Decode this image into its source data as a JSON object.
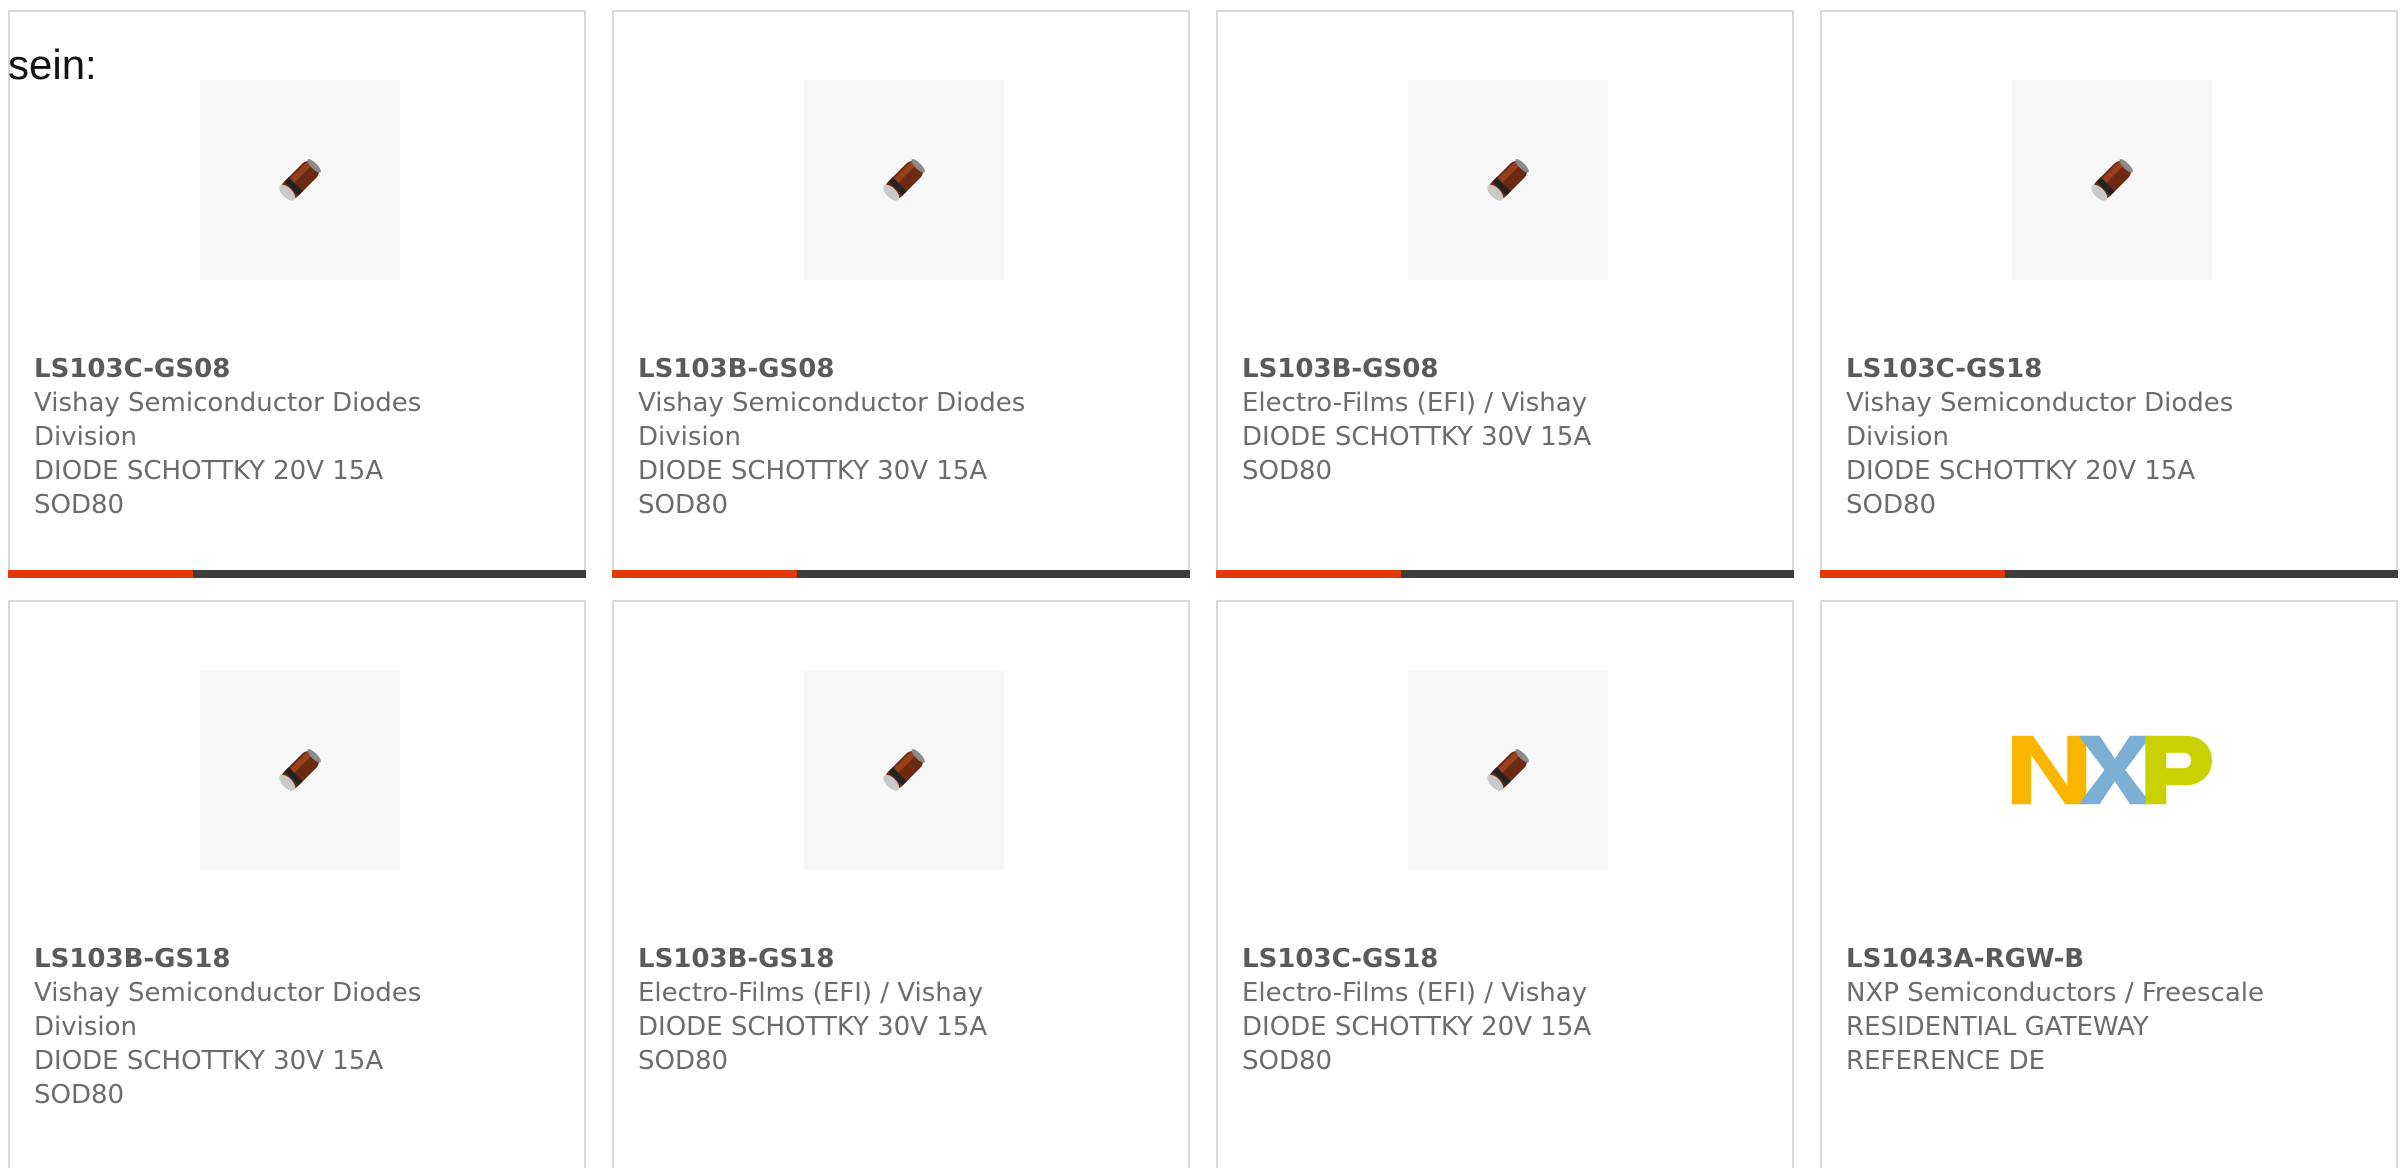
{
  "heading": "sein:",
  "colors": {
    "accent": "#e2380b",
    "bar_track": "#3d3d3d",
    "card_border": "#d8d8d8",
    "text": "#6c6c6c"
  },
  "cards": [
    {
      "part_number": "LS103C-GS08",
      "manufacturer_line1": "Vishay Semiconductor Diodes",
      "manufacturer_line2": "Division",
      "description_line1": "DIODE SCHOTTKY 20V 15A",
      "description_line2": "SOD80",
      "image_icon": "diode-image",
      "progress": 0.32
    },
    {
      "part_number": "LS103B-GS08",
      "manufacturer_line1": "Vishay Semiconductor Diodes",
      "manufacturer_line2": "Division",
      "description_line1": "DIODE SCHOTTKY 30V 15A",
      "description_line2": "SOD80",
      "image_icon": "diode-image",
      "progress": 0.32
    },
    {
      "part_number": "LS103B-GS08",
      "manufacturer_line1": "Electro-Films (EFI) / Vishay",
      "manufacturer_line2": "",
      "description_line1": "DIODE SCHOTTKY 30V 15A",
      "description_line2": "SOD80",
      "image_icon": "diode-image",
      "progress": 0.32
    },
    {
      "part_number": "LS103C-GS18",
      "manufacturer_line1": "Vishay Semiconductor Diodes",
      "manufacturer_line2": "Division",
      "description_line1": "DIODE SCHOTTKY 20V 15A",
      "description_line2": "SOD80",
      "image_icon": "diode-image",
      "progress": 0.32
    },
    {
      "part_number": "LS103B-GS18",
      "manufacturer_line1": "Vishay Semiconductor Diodes",
      "manufacturer_line2": "Division",
      "description_line1": "DIODE SCHOTTKY 30V 15A",
      "description_line2": "SOD80",
      "image_icon": "diode-image",
      "progress": null
    },
    {
      "part_number": "LS103B-GS18",
      "manufacturer_line1": "Electro-Films (EFI) / Vishay",
      "manufacturer_line2": "",
      "description_line1": "DIODE SCHOTTKY 30V 15A",
      "description_line2": "SOD80",
      "image_icon": "diode-image",
      "progress": null
    },
    {
      "part_number": "LS103C-GS18",
      "manufacturer_line1": "Electro-Films (EFI) / Vishay",
      "manufacturer_line2": "",
      "description_line1": "DIODE SCHOTTKY 20V 15A",
      "description_line2": "SOD80",
      "image_icon": "diode-image",
      "progress": null
    },
    {
      "part_number": "LS1043A-RGW-B",
      "manufacturer_line1": "NXP Semiconductors / Freescale",
      "manufacturer_line2": "",
      "description_line1": "RESIDENTIAL GATEWAY",
      "description_line2": "REFERENCE DE",
      "image_icon": "nxp-logo",
      "progress": null
    }
  ]
}
